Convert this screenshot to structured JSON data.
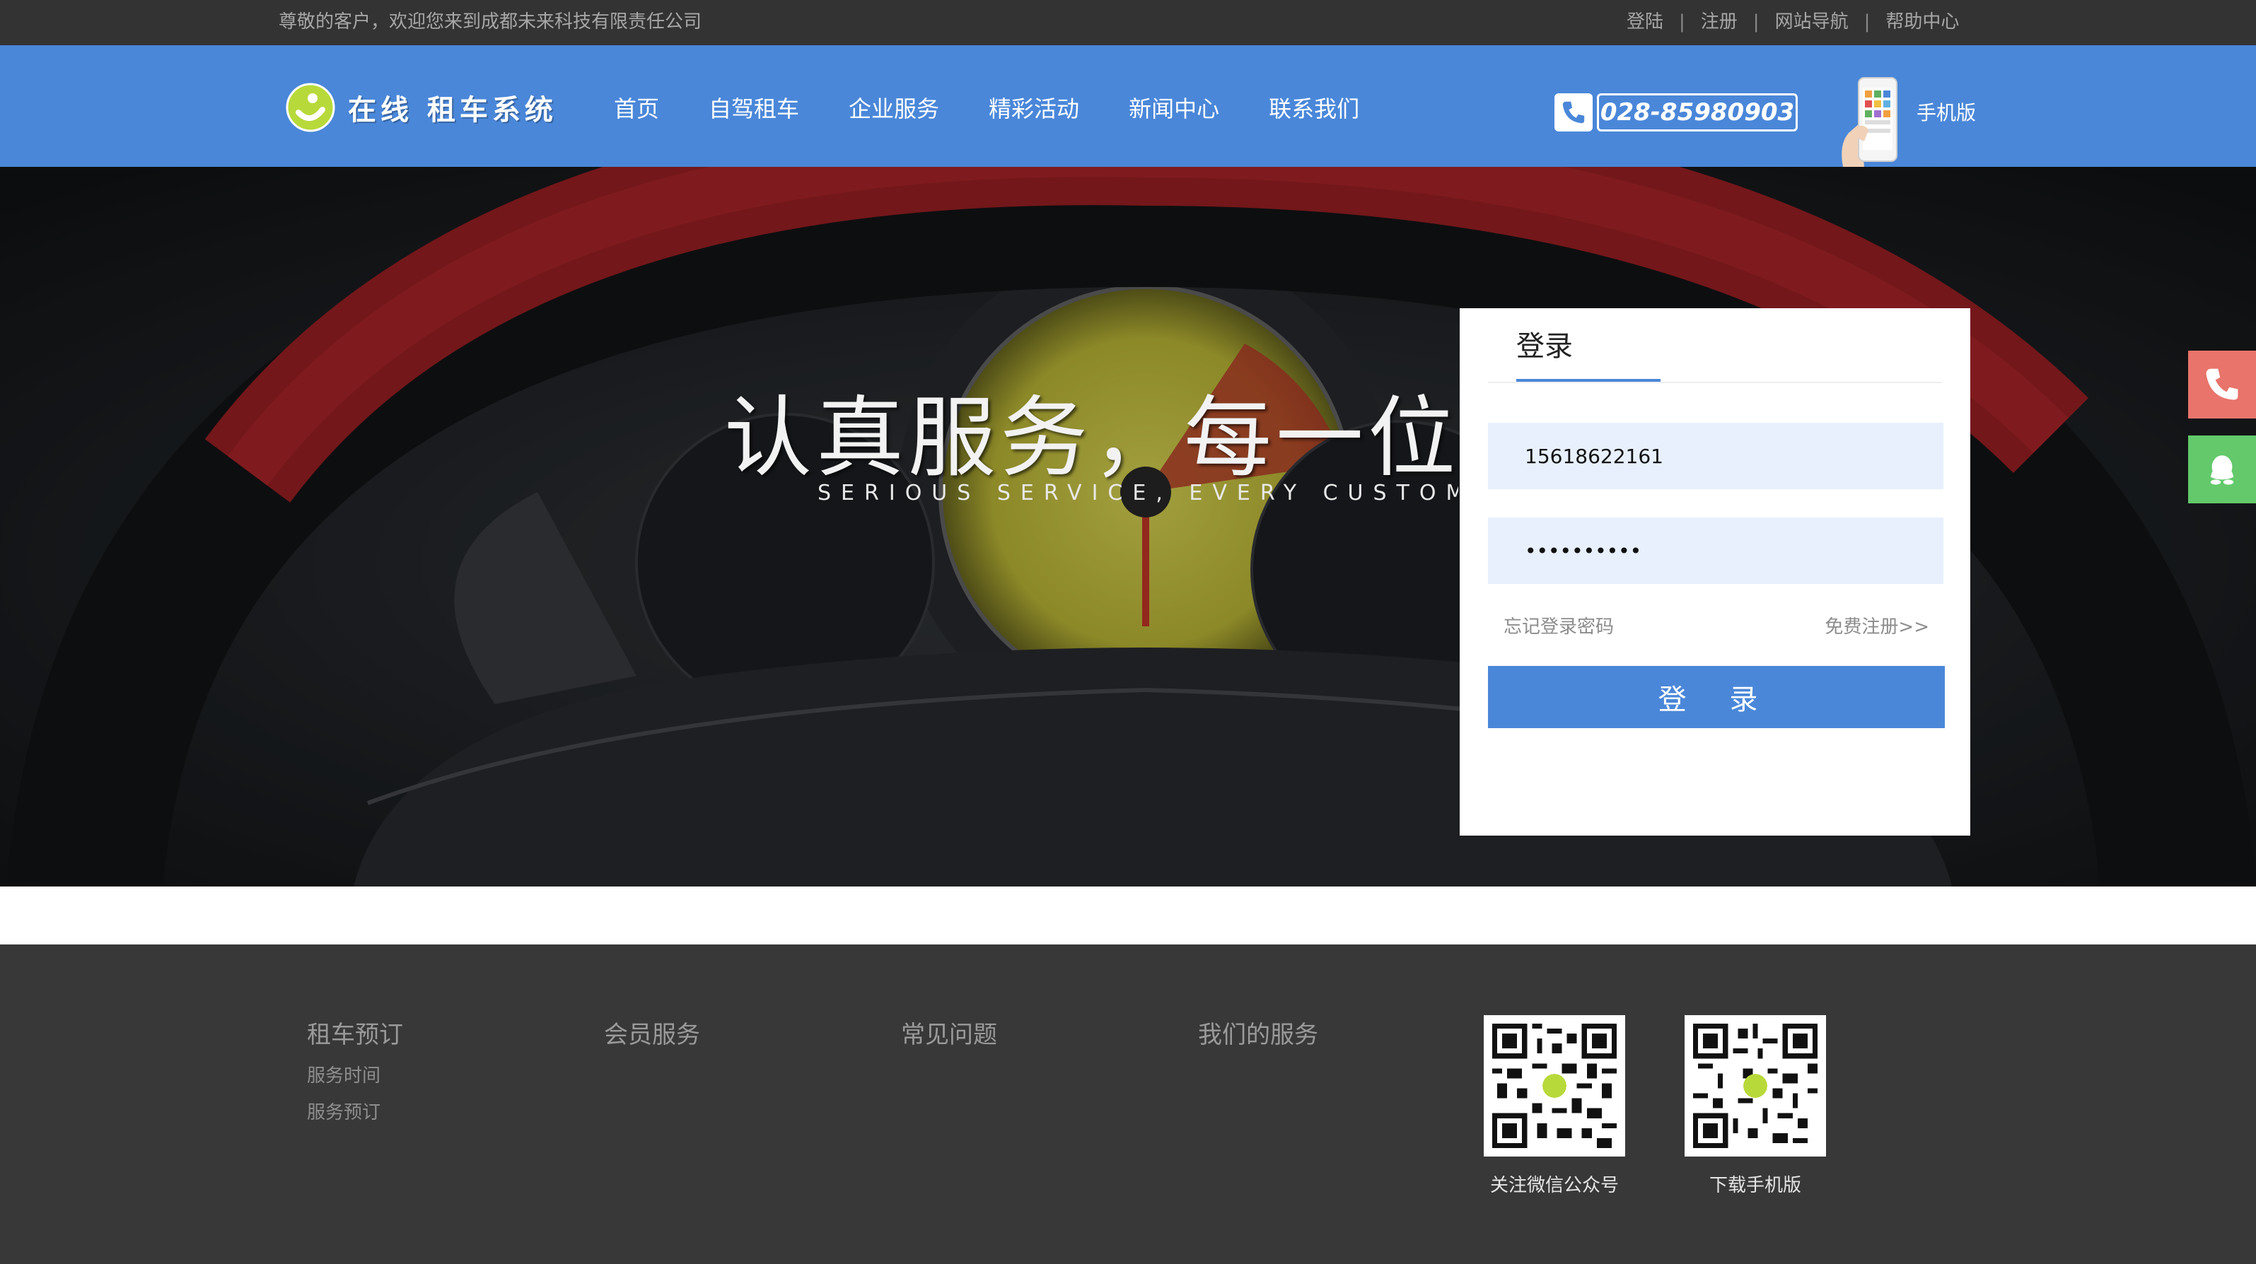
{
  "topbar": {
    "welcome": "尊敬的客户，欢迎您来到成都未来科技有限责任公司",
    "links": [
      "登陆",
      "注册",
      "网站导航",
      "帮助中心"
    ],
    "separator": "|"
  },
  "header": {
    "logo_text": "在线 租车系统",
    "nav": [
      "首页",
      "自驾租车",
      "企业服务",
      "精彩活动",
      "新闻中心",
      "联系我们"
    ],
    "phone": "028-85980903",
    "mobile_label": "手机版"
  },
  "hero": {
    "slogan": "认真服务，每一位客户",
    "slogan_en": "SERIOUS SERVICE, EVERY CUSTOMER"
  },
  "login": {
    "tab": "登录",
    "username_value": "15618622161",
    "password_value": "••••••••••",
    "forgot": "忘记登录密码",
    "register": "免费注册>>",
    "submit": "登 录"
  },
  "footer": {
    "columns": [
      {
        "title": "租车预订",
        "links": [
          "服务时间",
          "服务预订"
        ]
      },
      {
        "title": "会员服务",
        "links": []
      },
      {
        "title": "常见问题",
        "links": []
      },
      {
        "title": "我们的服务",
        "links": []
      }
    ],
    "qr_codes": [
      {
        "label": "关注微信公众号"
      },
      {
        "label": "下载手机版"
      }
    ]
  },
  "colors": {
    "brand_blue": "#4a87d9",
    "topbar": "#333333",
    "footer": "#383838",
    "side_phone": "#e8746b",
    "side_qq": "#63c96b"
  }
}
